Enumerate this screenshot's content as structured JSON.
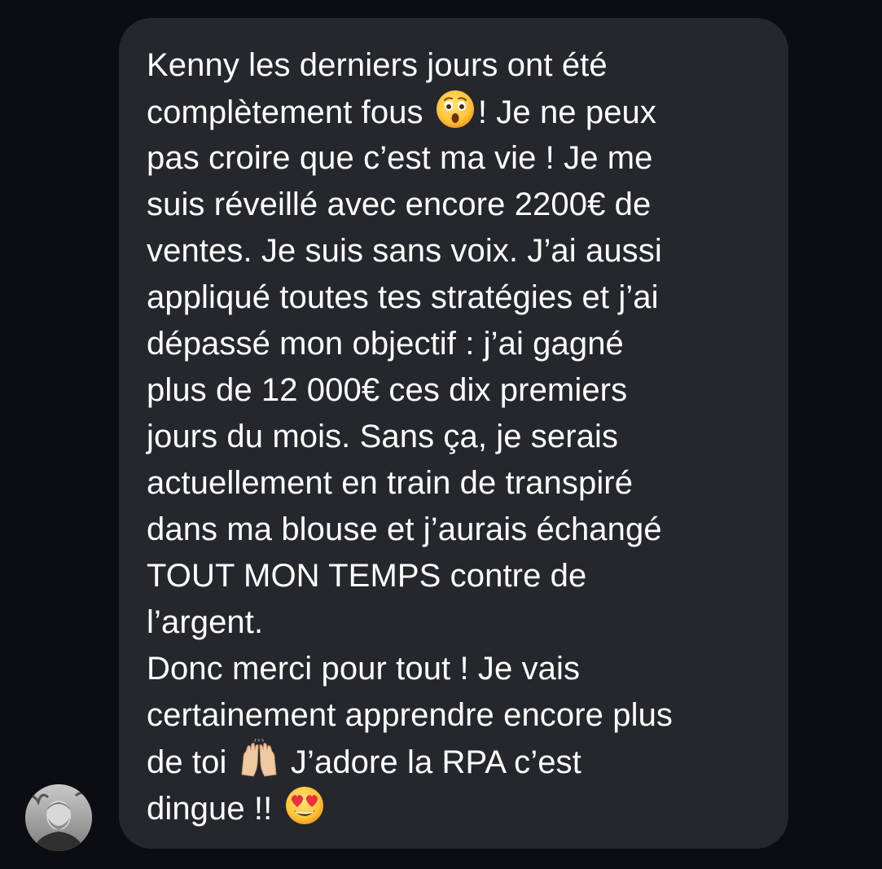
{
  "message": {
    "lines": [
      "Kenny les derniers jours ont été",
      "complètement fous",
      "! Je ne peux",
      "pas croire que c’est ma vie ! Je me",
      "suis réveillé avec encore 2200€ de",
      "ventes. Je suis sans voix. J’ai aussi",
      "appliqué toutes tes stratégies et j’ai",
      "dépassé mon objectif : j’ai gagné",
      "plus de 12 000€ ces dix premiers",
      "jours du mois. Sans ça, je serais",
      "actuellement en train de transpiré",
      "dans ma blouse et j’aurais échangé",
      "TOUT MON TEMPS contre de",
      "l’argent.",
      "Donc merci pour tout ! Je vais",
      "certainement apprendre encore plus",
      "de toi",
      "J’adore la RPA c’est",
      "dingue !!"
    ],
    "emojis": {
      "astonished": "astonished-face-emoji",
      "raised_hands": "raising-hands-emoji",
      "heart_eyes": "heart-eyes-emoji"
    }
  },
  "sender": {
    "avatar": "profile-photo-avatar"
  },
  "colors": {
    "background": "#0b0d12",
    "bubble": "#25272d",
    "text": "#ffffff"
  }
}
